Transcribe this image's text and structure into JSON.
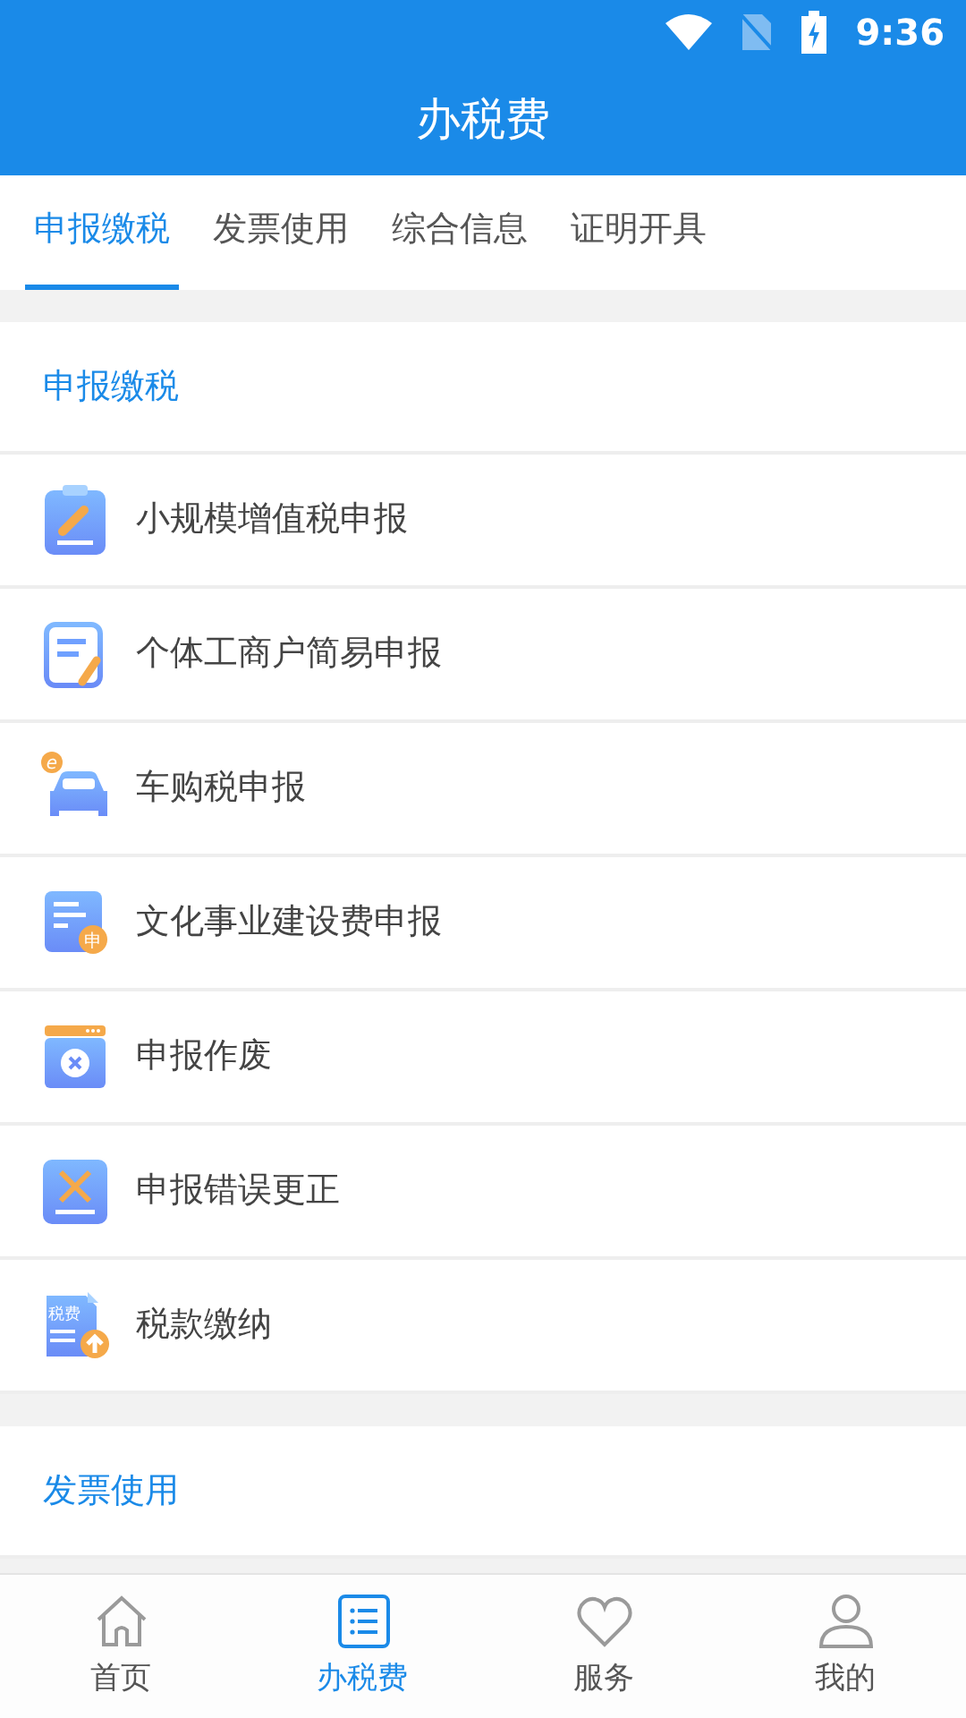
{
  "status_bar": {
    "time": "9:36"
  },
  "header": {
    "title": "办税费"
  },
  "tabs": [
    {
      "label": "申报缴税",
      "selected": true
    },
    {
      "label": "发票使用",
      "selected": false
    },
    {
      "label": "综合信息",
      "selected": false
    },
    {
      "label": "证明开具",
      "selected": false
    }
  ],
  "sections": [
    {
      "title": "申报缴税",
      "items": [
        {
          "label": "小规模增值税申报"
        },
        {
          "label": "个体工商户简易申报"
        },
        {
          "label": "车购税申报",
          "icon_text": "e"
        },
        {
          "label": "文化事业建设费申报",
          "icon_text": "申"
        },
        {
          "label": "申报作废"
        },
        {
          "label": "申报错误更正"
        },
        {
          "label": "税款缴纳",
          "icon_text": "税费"
        }
      ]
    },
    {
      "title": "发票使用"
    }
  ],
  "bottom_nav": [
    {
      "label": "首页",
      "selected": false
    },
    {
      "label": "办税费",
      "selected": true
    },
    {
      "label": "服务",
      "selected": false
    },
    {
      "label": "我的",
      "selected": false
    }
  ]
}
